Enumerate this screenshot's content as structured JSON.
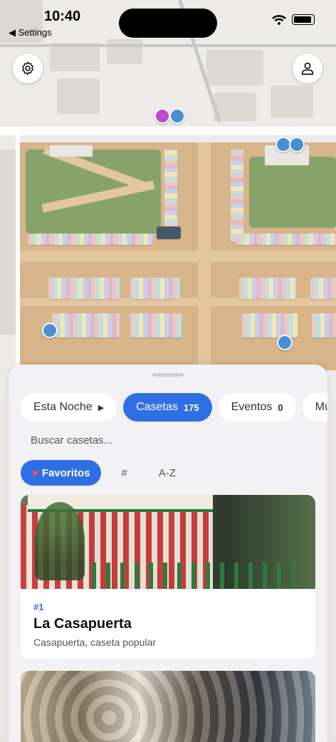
{
  "status_bar": {
    "time": "10:40",
    "back_label": "◀ Settings"
  },
  "map": {
    "aria": "feria map"
  },
  "sheet": {
    "tabs": [
      {
        "label": "Esta Noche",
        "count": ""
      },
      {
        "label": "Casetas",
        "count": "175"
      },
      {
        "label": "Eventos",
        "count": "0"
      },
      {
        "label": "Mú",
        "count": ""
      }
    ],
    "search_placeholder": "Buscar casetas...",
    "filters": {
      "favorites": "Favoritos",
      "number": "#",
      "alpha": "A-Z"
    },
    "cards": [
      {
        "number": "#1",
        "title": "La Casapuerta",
        "subtitle": "Casapuerta, caseta popular"
      }
    ]
  },
  "colors": {
    "accent": "#2f6fe4"
  }
}
